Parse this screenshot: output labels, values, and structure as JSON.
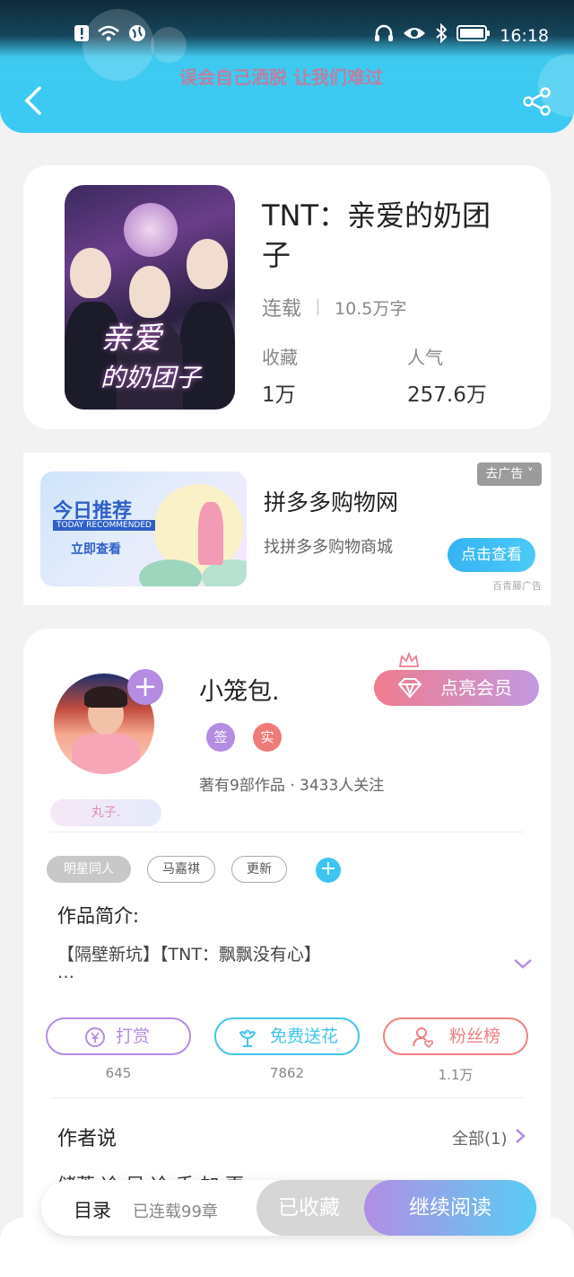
{
  "status_bar": {
    "time": "16:18"
  },
  "header": {
    "marquee": "误会自己洒脱 让我们难过",
    "back_icon": "chevron-left-icon",
    "share_icon": "share-icon"
  },
  "book": {
    "title_line1": "TNT：亲爱的奶团",
    "title_line2": "子",
    "cover_text_1": "亲爱",
    "cover_text_2": "的奶团子",
    "status": "连载",
    "words": "10.5万字",
    "favorites_label": "收藏",
    "favorites_value": "1万",
    "popularity_label": "人气",
    "popularity_value": "257.6万"
  },
  "ad": {
    "image_title": "今日推荐",
    "image_en": "TODAY RECOMMENDED",
    "image_cta": "立即查看",
    "title": "拼多多购物网",
    "subtitle": "找拼多多购物商城",
    "close_label": "去广告",
    "button": "点击查看",
    "source": "百青藤广告"
  },
  "author": {
    "name": "小笼包.",
    "vip_button": "点亮会员",
    "badge_sign": "签",
    "badge_real": "实",
    "badge_sign_color": "#b48ce2",
    "badge_real_color": "#f07a7a",
    "stats": "著有9部作品 · 3433人关注",
    "pendant": "丸子."
  },
  "tags": [
    "明星同人",
    "马嘉祺",
    "更新"
  ],
  "intro": {
    "title": "作品简介:",
    "text": "【隔壁新坑】【TNT：飘飘没有心】",
    "more": "…"
  },
  "actions": [
    {
      "label": "打赏",
      "count": "645",
      "color": "#b48ce2",
      "icon": "yuan-icon"
    },
    {
      "label": "免费送花",
      "count": "7862",
      "color": "#3fc5ef",
      "icon": "flower-icon"
    },
    {
      "label": "粉丝榜",
      "count": "1.1万",
      "color": "#f08080",
      "icon": "fan-user-icon"
    }
  ],
  "author_say": {
    "title": "作者说",
    "all": "全部(1)",
    "peek": "储蓄 冷 早 冷 手 加 更"
  },
  "bottom": {
    "toc": "目录",
    "chapters": "已连载99章",
    "collected": "已收藏",
    "read": "继续阅读"
  }
}
